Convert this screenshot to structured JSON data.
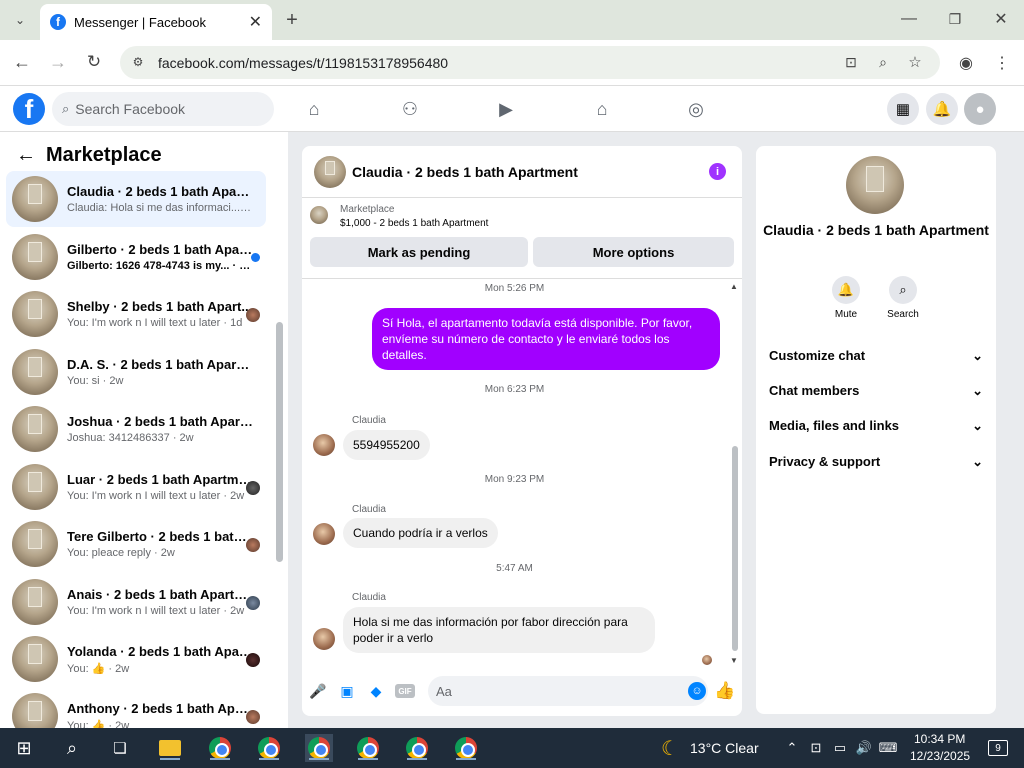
{
  "browser": {
    "tab_title": "Messenger | Facebook",
    "url": "facebook.com/messages/t/1198153178956480"
  },
  "fb": {
    "search_placeholder": "Search Facebook"
  },
  "left": {
    "heading": "Marketplace",
    "conversations": [
      {
        "name": "Claudia · 2 beds 1 bath Apartme...",
        "preview": "Claudia: Hola si me das informaci... · 16h",
        "active": true
      },
      {
        "name": "Gilberto · 2 beds 1 bath Apart...",
        "preview": "Gilberto: 1626 478-4743 is my... · 21h",
        "unread": true
      },
      {
        "name": "Shelby · 2 beds 1 bath Apart...",
        "preview": "You: I'm work n I will text u later · 1d"
      },
      {
        "name": "D.A. S. · 2 beds 1 bath Apartment",
        "preview": "You: si · 2w"
      },
      {
        "name": "Joshua · 2 beds 1 bath Apartment",
        "preview": "Joshua: 3412486337 · 2w"
      },
      {
        "name": "Luar · 2 beds 1 bath Apartment",
        "preview": "You: I'm work n I will text u later · 2w"
      },
      {
        "name": "Tere Gilberto · 2 beds 1 bath ...",
        "preview": "You: pleace reply · 2w"
      },
      {
        "name": "Anais · 2 beds 1 bath Apartm...",
        "preview": "You: I'm work n I will text u later · 2w"
      },
      {
        "name": "Yolanda · 2 beds 1 bath Apart...",
        "preview": "You: 👍 · 2w"
      },
      {
        "name": "Anthony · 2 beds 1 bath Apar...",
        "preview": "You: 👍 · 2w"
      }
    ]
  },
  "chat": {
    "title": "Claudia · 2 beds 1 bath Apartment",
    "marketplace_label": "Marketplace",
    "listing": "$1,000 - 2 beds 1 bath Apartment",
    "btn_pending": "Mark as pending",
    "btn_more": "More options",
    "ts1": "Mon 5:26 PM",
    "out1": "Sí Hola, el apartamento todavía está disponible. Por favor, envíeme su número de contacto y le enviaré todos los detalles.",
    "ts2": "Mon 6:23 PM",
    "sender": "Claudia",
    "in1": "5594955200",
    "ts3": "Mon 9:23 PM",
    "in2": "Cuando podría ir a verlos",
    "ts4": "5:47 AM",
    "in3": "Hola si me das información por fabor dirección para poder ir a verlo",
    "input_placeholder": "Aa",
    "gif_label": "GIF"
  },
  "right": {
    "title": "Claudia · 2 beds 1 bath Apartment",
    "mute": "Mute",
    "search": "Search",
    "sections": [
      "Customize chat",
      "Chat members",
      "Media, files and links",
      "Privacy & support"
    ]
  },
  "taskbar": {
    "weather": "13°C  Clear",
    "time": "10:34 PM",
    "date": "12/23/2025",
    "notif": "9"
  },
  "colors": {
    "accent": "#1877f2",
    "outgoing": "#a100ff",
    "taskbar": "#1f2c3a"
  }
}
